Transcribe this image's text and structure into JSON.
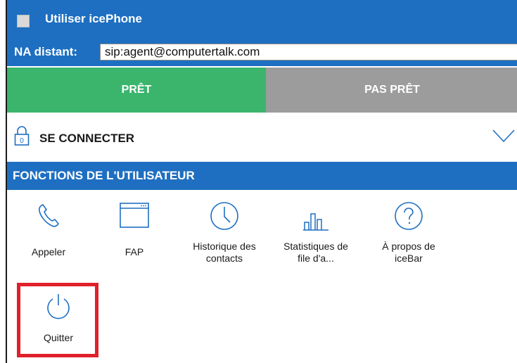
{
  "header": {
    "title": "Utiliser icePhone",
    "na_label": "NA distant:",
    "na_value": "sip:agent@computertalk.com"
  },
  "status": {
    "ready_label": "PRÊT",
    "not_ready_label": "PAS PRÊT",
    "ready_color": "#3bb56c",
    "not_ready_color": "#9c9c9c"
  },
  "connect": {
    "label": "SE CONNECTER",
    "lock_digit": "0"
  },
  "functions": {
    "title": "FONCTIONS DE L'UTILISATEUR",
    "items": [
      {
        "label": "Appeler",
        "icon": "phone-icon"
      },
      {
        "label": "FAP",
        "icon": "window-icon"
      },
      {
        "label": "Historique des contacts",
        "icon": "clock-icon"
      },
      {
        "label": "Statistiques de file d'a...",
        "icon": "bar-chart-icon"
      },
      {
        "label": "À propos de iceBar",
        "icon": "help-icon"
      },
      {
        "label": "Quitter",
        "icon": "power-icon"
      }
    ]
  },
  "colors": {
    "brand_blue": "#1e6fc1",
    "icon_blue": "#1e6fc1",
    "highlight_red": "#e0202a"
  }
}
